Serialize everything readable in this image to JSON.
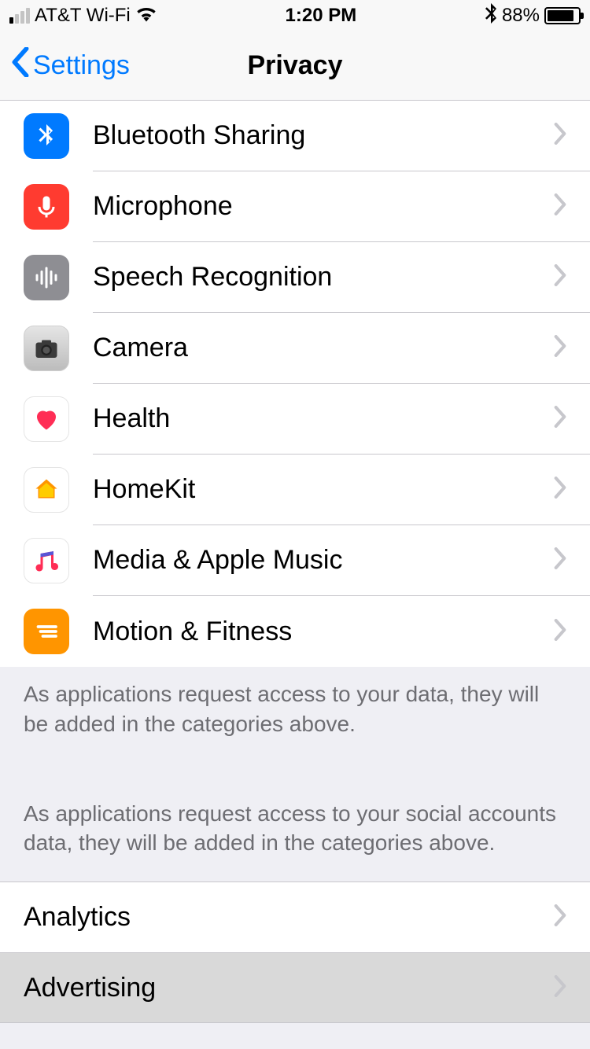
{
  "status": {
    "carrier": "AT&T Wi-Fi",
    "time": "1:20 PM",
    "battery_pct": "88%",
    "battery_fill_pct": 88
  },
  "nav": {
    "back_label": "Settings",
    "title": "Privacy"
  },
  "rows": [
    {
      "label": "Bluetooth Sharing",
      "icon": "bluetooth-icon"
    },
    {
      "label": "Microphone",
      "icon": "microphone-icon"
    },
    {
      "label": "Speech Recognition",
      "icon": "speech-icon"
    },
    {
      "label": "Camera",
      "icon": "camera-icon"
    },
    {
      "label": "Health",
      "icon": "health-icon"
    },
    {
      "label": "HomeKit",
      "icon": "homekit-icon"
    },
    {
      "label": "Media & Apple Music",
      "icon": "music-icon"
    },
    {
      "label": "Motion & Fitness",
      "icon": "motion-icon"
    }
  ],
  "footer": {
    "text1": "As applications request access to your data, they will be added in the categories above.",
    "text2": "As applications request access to your social accounts data, they will be added in the categories above."
  },
  "plain_rows": [
    {
      "label": "Analytics"
    },
    {
      "label": "Advertising"
    }
  ]
}
